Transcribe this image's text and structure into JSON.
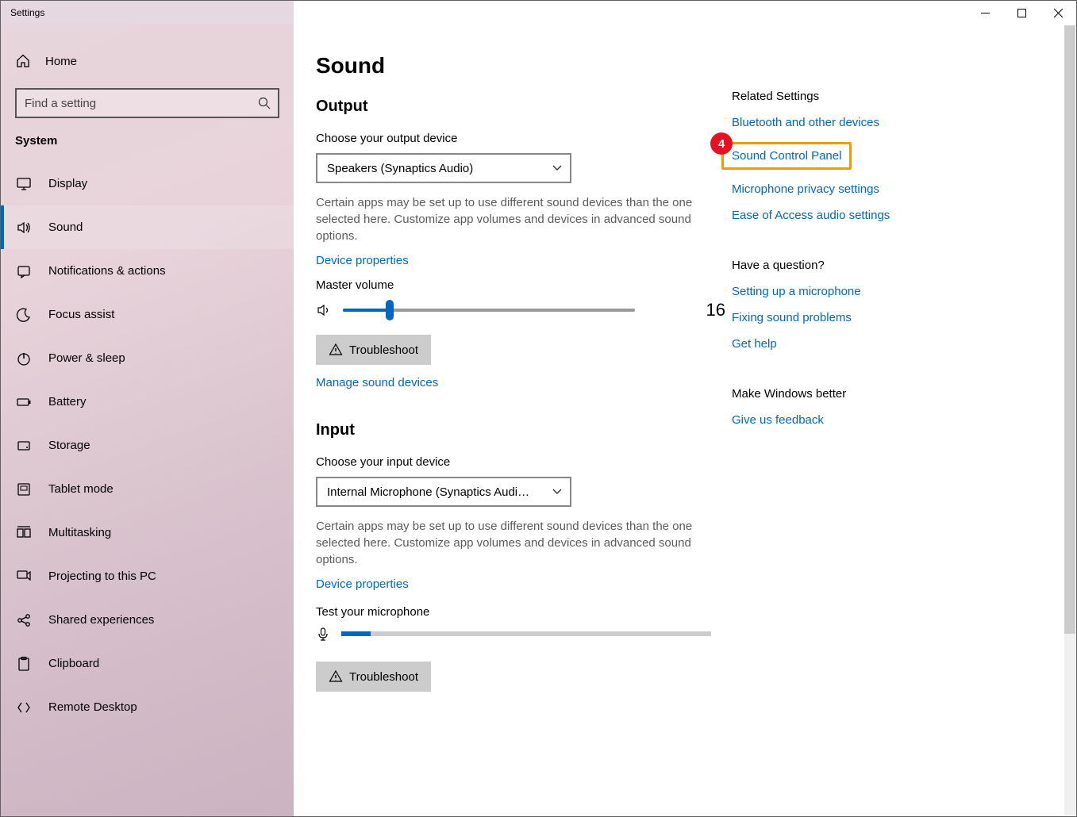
{
  "window": {
    "title": "Settings"
  },
  "nav": {
    "home": "Home",
    "search_placeholder": "Find a setting",
    "category": "System",
    "items": [
      {
        "label": "Display",
        "icon": "display"
      },
      {
        "label": "Sound",
        "icon": "sound",
        "active": true
      },
      {
        "label": "Notifications & actions",
        "icon": "notifications"
      },
      {
        "label": "Focus assist",
        "icon": "moon"
      },
      {
        "label": "Power & sleep",
        "icon": "power"
      },
      {
        "label": "Battery",
        "icon": "battery"
      },
      {
        "label": "Storage",
        "icon": "storage"
      },
      {
        "label": "Tablet mode",
        "icon": "tablet"
      },
      {
        "label": "Multitasking",
        "icon": "multitasking"
      },
      {
        "label": "Projecting to this PC",
        "icon": "projecting"
      },
      {
        "label": "Shared experiences",
        "icon": "shared"
      },
      {
        "label": "Clipboard",
        "icon": "clipboard"
      },
      {
        "label": "Remote Desktop",
        "icon": "remote"
      }
    ]
  },
  "main": {
    "title": "Sound",
    "output": {
      "heading": "Output",
      "choose_label": "Choose your output device",
      "device": "Speakers (Synaptics Audio)",
      "help": "Certain apps may be set up to use different sound devices than the one selected here. Customize app volumes and devices in advanced sound options.",
      "device_properties": "Device properties",
      "master_volume_label": "Master volume",
      "volume_percent": 16,
      "volume_value": "16",
      "troubleshoot": "Troubleshoot",
      "manage": "Manage sound devices"
    },
    "input": {
      "heading": "Input",
      "choose_label": "Choose your input device",
      "device": "Internal Microphone (Synaptics Audi…",
      "help": "Certain apps may be set up to use different sound devices than the one selected here. Customize app volumes and devices in advanced sound options.",
      "device_properties": "Device properties",
      "test_label": "Test your microphone",
      "mic_percent": 8,
      "troubleshoot": "Troubleshoot"
    }
  },
  "aside": {
    "related": {
      "heading": "Related Settings",
      "links": {
        "bluetooth": "Bluetooth and other devices",
        "sound_control_panel": "Sound Control Panel",
        "mic_privacy": "Microphone privacy settings",
        "ease_audio": "Ease of Access audio settings"
      }
    },
    "question": {
      "heading": "Have a question?",
      "links": {
        "setup_mic": "Setting up a microphone",
        "fix_sound": "Fixing sound problems",
        "get_help": "Get help"
      }
    },
    "feedback": {
      "heading": "Make Windows better",
      "link": "Give us feedback"
    }
  },
  "annotation": {
    "badge": "4"
  }
}
